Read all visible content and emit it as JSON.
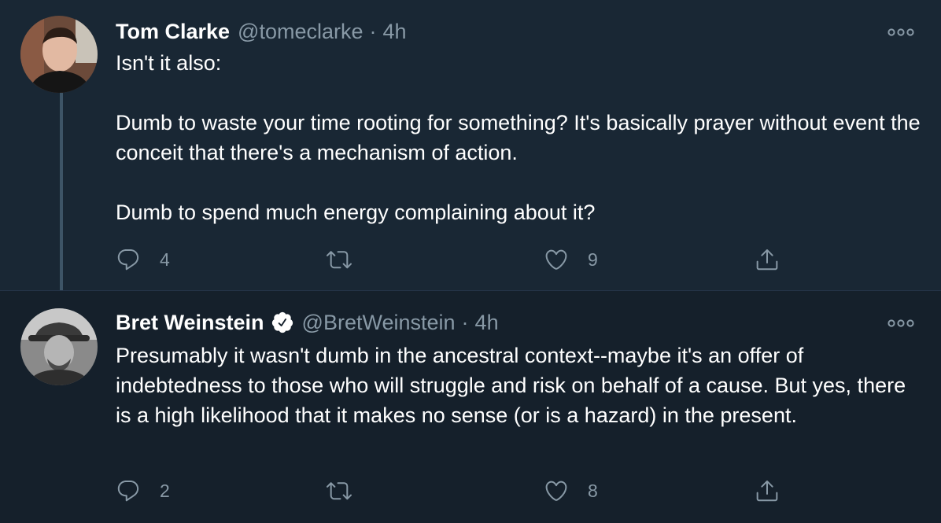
{
  "tweets": [
    {
      "name": "Tom Clarke",
      "handle": "@tomeclarke",
      "separator": "·",
      "time": "4h",
      "verified": false,
      "avatar_icon": "user-avatar-tom-clarke",
      "text": "Isn't it also:\n\nDumb to waste your time rooting for something? It's basically prayer without event the conceit that there's a mechanism of action.\n\nDumb to spend much energy complaining about it?",
      "replies": "4",
      "retweets": "",
      "likes": "9"
    },
    {
      "name": "Bret Weinstein",
      "handle": "@BretWeinstein",
      "separator": "·",
      "time": "4h",
      "verified": true,
      "avatar_icon": "user-avatar-bret-weinstein",
      "text": "Presumably it wasn't dumb in the ancestral context--maybe it's an offer of indebtedness to those who will struggle and risk on behalf of a cause. But yes, there is a high likelihood that it makes no sense (or is a hazard) in the present.",
      "replies": "2",
      "retweets": "",
      "likes": "8"
    }
  ],
  "colors": {
    "background": "#15202b",
    "highlight_background": "#192734",
    "secondary_text": "#8899a6",
    "verified_badge": "#ffffff",
    "thread_line": "#3d5466"
  },
  "icons": [
    "reply-icon",
    "retweet-icon",
    "like-icon",
    "share-icon",
    "more-options-icon",
    "verified-badge-icon"
  ]
}
